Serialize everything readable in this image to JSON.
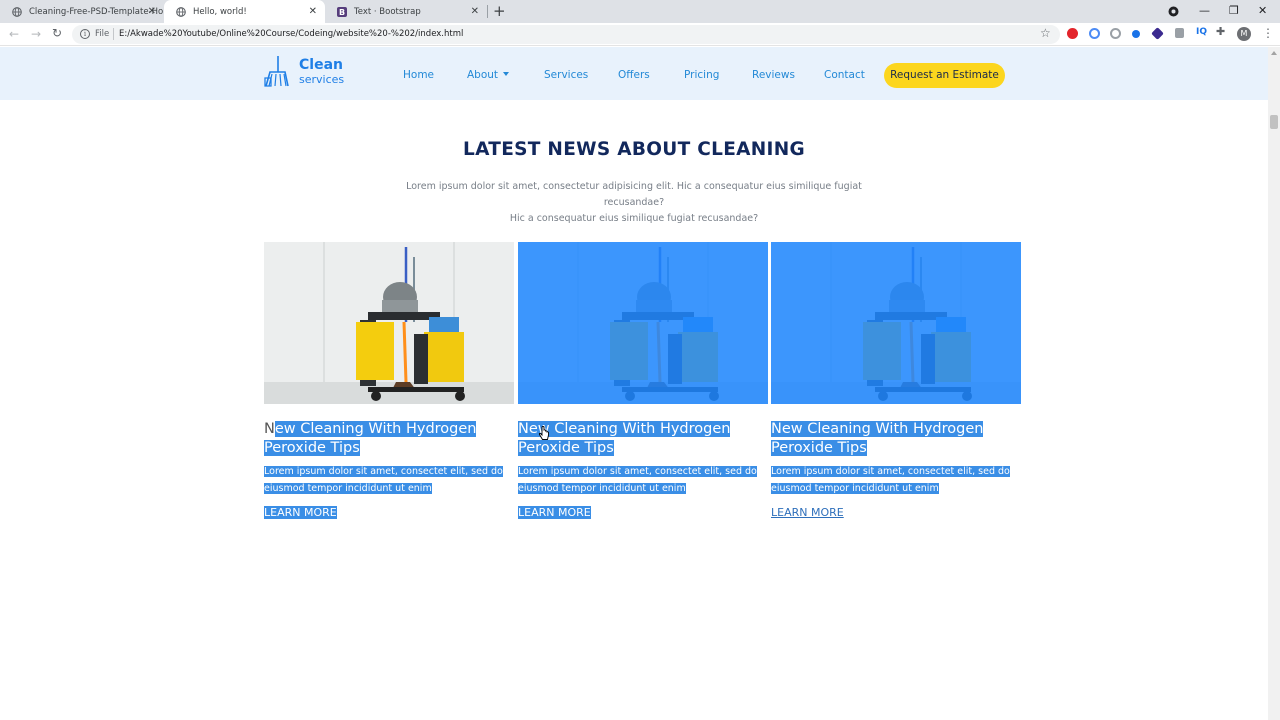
{
  "browser": {
    "tabs": [
      {
        "title": "Cleaning-Free-PSD-Template-Ho",
        "active": false
      },
      {
        "title": "Hello, world!",
        "active": true
      },
      {
        "title": "Text · Bootstrap",
        "active": false
      }
    ],
    "close_glyph": "✕",
    "new_tab_glyph": "+",
    "window_controls": [
      "—",
      "❐",
      "✕"
    ],
    "scheme_label": "File",
    "url": "E:/Akwade%20Youtube/Online%20Course/Codeing/website%20-%202/index.html",
    "avatar_initial": "M",
    "extensions": [
      "opera-icon",
      "vpn-icon",
      "tracker-icon",
      "dot-icon",
      "hex-icon",
      "clip-icon",
      "iq-icon",
      "puzzle-icon"
    ]
  },
  "site": {
    "logo": {
      "line1": "Clean",
      "line2": "services"
    },
    "nav": {
      "home": "Home",
      "about": "About",
      "services": "Services",
      "offers": "Offers",
      "pricing": "Pricing",
      "reviews": "Reviews",
      "contact": "Contact",
      "cta": "Request an Estimate"
    },
    "section": {
      "title": "LATEST NEWS ABOUT CLEANING",
      "subtitle_line1": "Lorem ipsum dolor sit amet, consectetur adipisicing elit. Hic a consequatur eius similique fugiat recusandae?",
      "subtitle_line2": "Hic a consequatur eius similique fugiat recusandae?"
    },
    "cards": [
      {
        "title_first": "N",
        "title_rest": "ew Cleaning With Hydrogen Peroxide Tips",
        "text": "Lorem ipsum dolor sit amet, consectet elit, sed do eiusmod tempor incididunt ut enim",
        "link": "LEARN MORE"
      },
      {
        "title_first": "",
        "title_rest": "New Cleaning With Hydrogen Peroxide Tips",
        "text": "Lorem ipsum dolor sit amet, consectet elit, sed do eiusmod tempor incididunt ut enim",
        "link": "LEARN MORE"
      },
      {
        "title_first": "",
        "title_rest": "New Cleaning With Hydrogen Peroxide Tips",
        "text": "Lorem ipsum dolor sit amet, consectet elit, sed do eiusmod tempor incididunt ut enim",
        "link": "LEARN MORE"
      }
    ]
  },
  "colors": {
    "nav_bg": "#e8f2fc",
    "brand_blue": "#1f7fe6",
    "cta_yellow": "#fcd61e",
    "heading_navy": "#12285c",
    "selection_blue": "#3a8ee6",
    "image_overlay": "#1e87ff"
  }
}
